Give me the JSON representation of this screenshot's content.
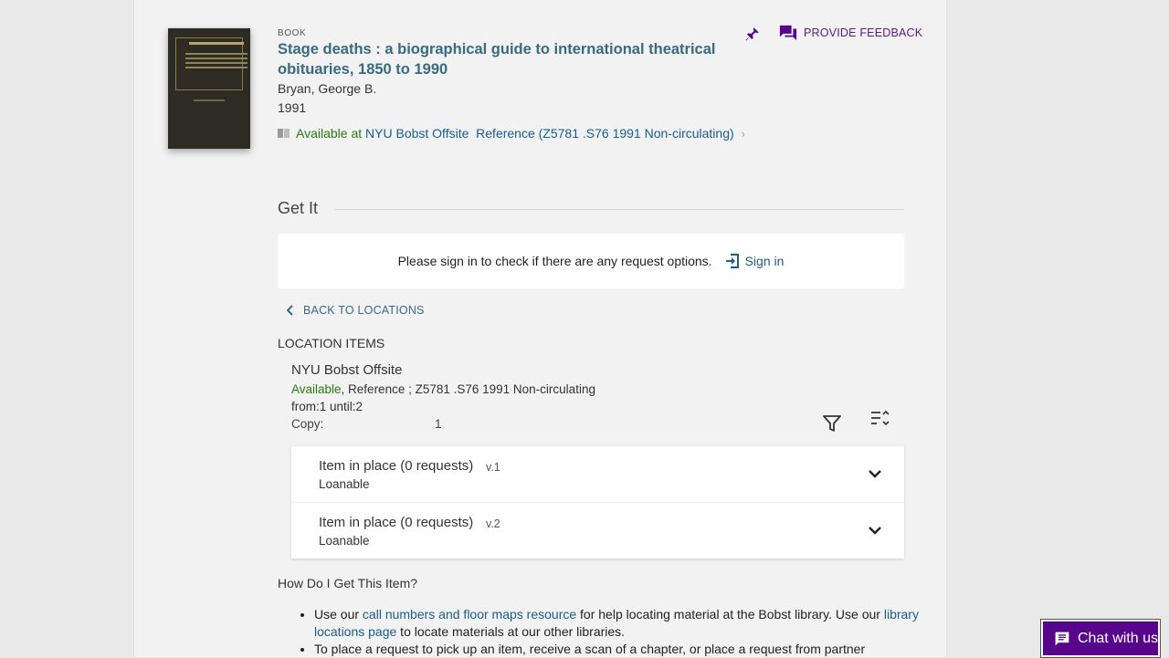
{
  "record": {
    "type": "Book",
    "title": "Stage deaths : a biographical guide to international theatrical obituaries, 1850 to 1990",
    "author": "Bryan, George B.",
    "year": "1991",
    "availability_status": "Available at",
    "availability_location": "NYU Bobst Offsite",
    "availability_detail": "Reference (Z5781 .S76 1991 Non-circulating)"
  },
  "actions": {
    "feedback_label": "PROVIDE FEEDBACK"
  },
  "get_it": {
    "section_title": "Get It",
    "signin_message": "Please sign in to check if there are any request options.",
    "signin_label": "Sign in",
    "back_label": "BACK TO LOCATIONS",
    "location_items_label": "LOCATION ITEMS",
    "location": {
      "name": "NYU Bobst Offsite",
      "status": "Available",
      "detail": ", Reference ; Z5781 .S76 1991 Non-circulating",
      "range": "from:1 until:2",
      "copy_label": "Copy:",
      "copy_value": "1"
    },
    "items": [
      {
        "status": "Item in place (0 requests)",
        "volume": "v.1",
        "policy": "Loanable"
      },
      {
        "status": "Item in place (0 requests)",
        "volume": "v.2",
        "policy": "Loanable"
      }
    ]
  },
  "how_do": {
    "title": "How Do I Get This Item?",
    "bullet1_pre": "Use our ",
    "bullet1_link1": "call numbers and floor maps resource",
    "bullet1_mid": " for help locating material at the Bobst library. Use our ",
    "bullet1_link2": "library locations page",
    "bullet1_post": " to locate materials at our other libraries.",
    "bullet2": "To place a request to pick up an item, receive a scan of a chapter, or place a request from partner"
  },
  "chat": {
    "label": "Chat with us"
  },
  "colors": {
    "accent_purple": "#57068c",
    "link_blue": "#1a5c8c",
    "available_green": "#2b7a10",
    "title_teal": "#3a6a80"
  }
}
